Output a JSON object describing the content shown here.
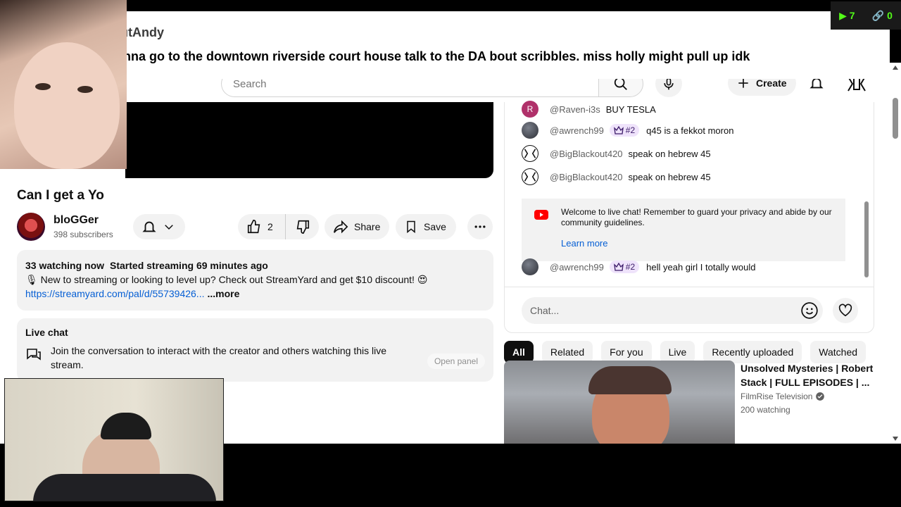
{
  "masthead": {
    "search_placeholder": "Search",
    "create_label": "Create"
  },
  "video": {
    "title": "Can I get a Yo",
    "channel_name": "bloGGer",
    "subscribers": "398 subscribers",
    "likes": "2",
    "share_label": "Share",
    "save_label": "Save"
  },
  "description": {
    "watching": "33 watching now",
    "started": "Started streaming 69 minutes ago",
    "text": "🎙 New to streaming or looking to level up? Check out StreamYard and get $10 discount! 😍",
    "link": "https://streamyard.com/pal/d/55739426...",
    "more": "...more"
  },
  "live_chat_card": {
    "title": "Live chat",
    "text": "Join the conversation to interact with the creator and others watching this live stream.",
    "open_panel": "Open panel"
  },
  "chat": {
    "messages": [
      {
        "author": "@Raven-i3s",
        "text": "BUY TESLA",
        "avatar_letter": "R",
        "badge": ""
      },
      {
        "author": "@awrench99",
        "text": "q45 is a fekkot moron",
        "avatar_letter": "",
        "badge": "#2"
      },
      {
        "author": "@BigBlackout420",
        "text": "speak on hebrew 45",
        "avatar_letter": "",
        "badge": ""
      },
      {
        "author": "@BigBlackout420",
        "text": "speak on hebrew 45",
        "avatar_letter": "",
        "badge": ""
      },
      {
        "author": "@awrench99",
        "text": "hell yeah girl I totally would",
        "avatar_letter": "",
        "badge": "#2"
      }
    ],
    "welcome_text": "Welcome to live chat! Remember to guard your privacy and abide by our community guidelines.",
    "learn_more": "Learn more",
    "input_placeholder": "Chat..."
  },
  "chips": [
    "All",
    "Related",
    "For you",
    "Live",
    "Recently uploaded",
    "Watched"
  ],
  "recommendation": {
    "title": "Unsolved Mysteries | Robert Stack | FULL EPISODES | ...",
    "channel": "FilmRise Television",
    "watching": "200 watching"
  },
  "overlay": {
    "username": "BlackoutAndy",
    "message": "i am gonna go to the downtown riverside court house talk to the DA bout scribbles. miss holly might pull up idk",
    "stat_viewers": "7",
    "stat_links": "0"
  },
  "colors": {
    "brand_green": "#53fc18",
    "link_blue": "#065fd4",
    "badge_purple": "#efe3fb"
  }
}
